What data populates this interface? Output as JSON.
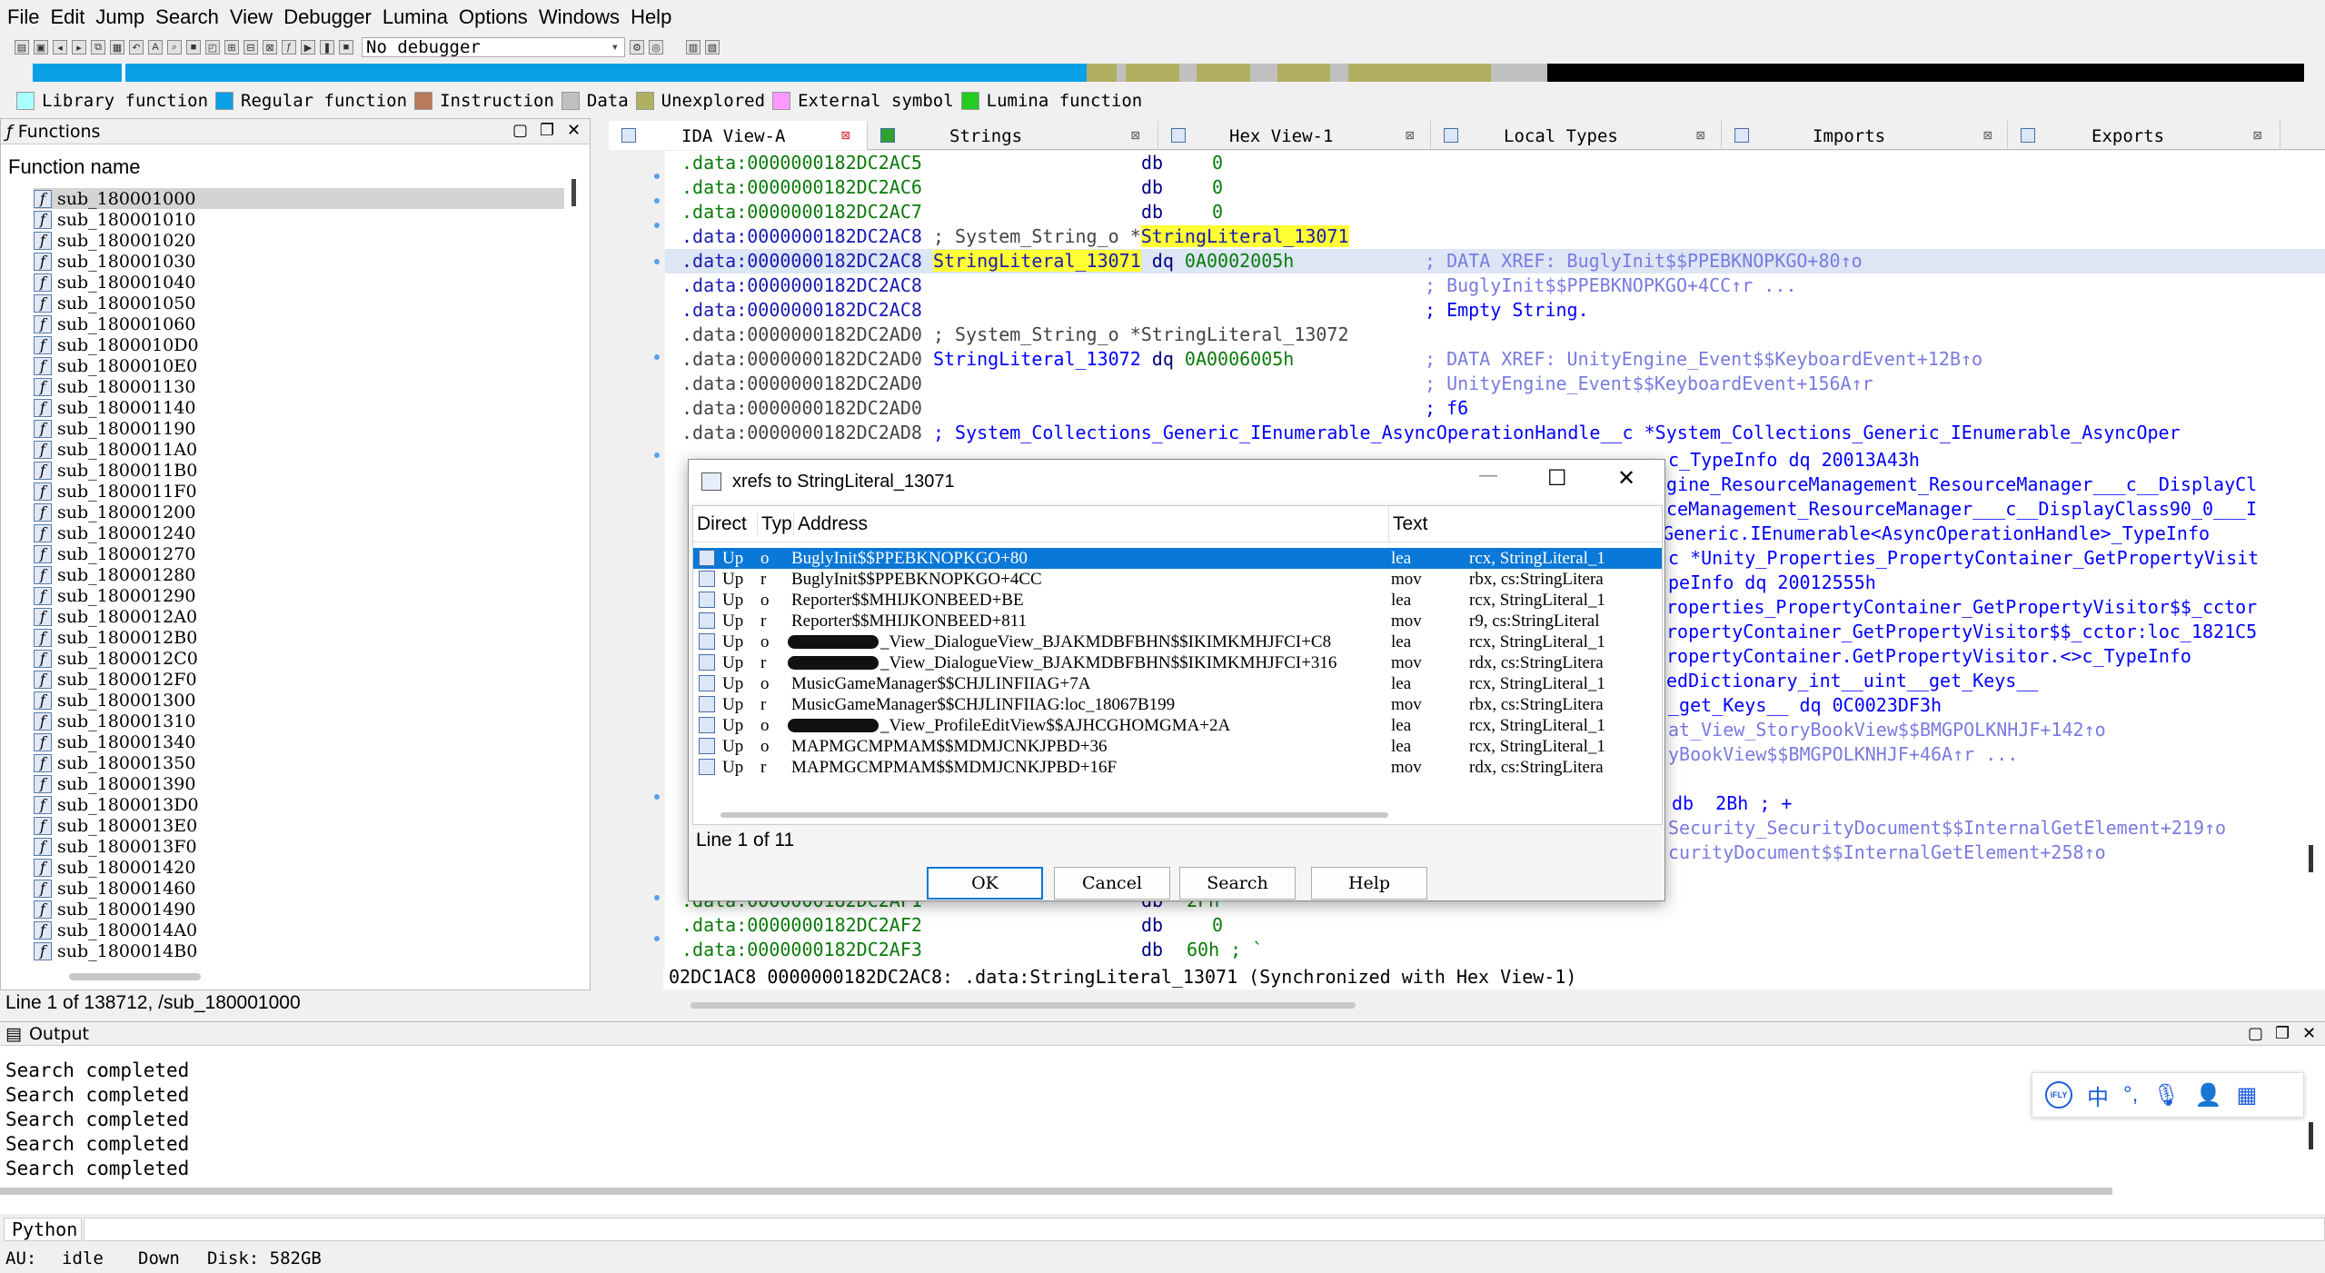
{
  "menu": [
    "File",
    "Edit",
    "Jump",
    "Search",
    "View",
    "Debugger",
    "Lumina",
    "Options",
    "Windows",
    "Help"
  ],
  "debugger_select": "No debugger",
  "legend": [
    {
      "label": "Library function",
      "color": "#aaffff"
    },
    {
      "label": "Regular function",
      "color": "#0aa0e6"
    },
    {
      "label": "Instruction",
      "color": "#b87a5a"
    },
    {
      "label": "Data",
      "color": "#c0c0c0"
    },
    {
      "label": "Unexplored",
      "color": "#b0b060"
    },
    {
      "label": "External symbol",
      "color": "#ff99ff"
    },
    {
      "label": "Lumina function",
      "color": "#22cc22"
    }
  ],
  "functions_panel": {
    "title": "Functions",
    "header": "Function name",
    "items": [
      "sub_180001000",
      "sub_180001010",
      "sub_180001020",
      "sub_180001030",
      "sub_180001040",
      "sub_180001050",
      "sub_180001060",
      "sub_1800010D0",
      "sub_1800010E0",
      "sub_180001130",
      "sub_180001140",
      "sub_180001190",
      "sub_1800011A0",
      "sub_1800011B0",
      "sub_1800011F0",
      "sub_180001200",
      "sub_180001240",
      "sub_180001270",
      "sub_180001280",
      "sub_180001290",
      "sub_1800012A0",
      "sub_1800012B0",
      "sub_1800012C0",
      "sub_1800012F0",
      "sub_180001300",
      "sub_180001310",
      "sub_180001340",
      "sub_180001350",
      "sub_180001390",
      "sub_1800013D0",
      "sub_1800013E0",
      "sub_1800013F0",
      "sub_180001420",
      "sub_180001460",
      "sub_180001490",
      "sub_1800014A0",
      "sub_1800014B0"
    ],
    "status": "Line 1 of 138712, /sub_180001000"
  },
  "tabs": [
    "IDA View-A",
    "Strings",
    "Hex View-1",
    "Local Types",
    "Imports",
    "Exports"
  ],
  "code_lines": [
    {
      "addr": ".data:0000000182DC2AC5",
      "label": "",
      "instr": "db",
      "arg": "0",
      "comment": ""
    },
    {
      "addr": ".data:0000000182DC2AC6",
      "label": "",
      "instr": "db",
      "arg": "0",
      "comment": ""
    },
    {
      "addr": ".data:0000000182DC2AC7",
      "label": "",
      "instr": "db",
      "arg": "0",
      "comment": ""
    },
    {
      "addr": ".data:0000000182DC2AC8",
      "label": "; System_String_o *",
      "instr": "StringLiteral_13071",
      "arg": "",
      "comment": ""
    },
    {
      "addr": ".data:0000000182DC2AC8",
      "label": "StringLiteral_13071",
      "instr": "dq",
      "arg": "0A0002005h",
      "comment": "; DATA XREF: BuglyInit$$PPEBKNOPKGO+80↑o"
    },
    {
      "addr": ".data:0000000182DC2AC8",
      "label": "",
      "instr": "",
      "arg": "",
      "comment": "; BuglyInit$$PPEBKNOPKGO+4CC↑r ..."
    },
    {
      "addr": ".data:0000000182DC2AC8",
      "label": "",
      "instr": "",
      "arg": "",
      "comment": "; Empty String."
    },
    {
      "addr": ".data:0000000182DC2AD0",
      "label": "; System_String_o *StringLiteral_13072",
      "instr": "",
      "arg": "",
      "comment": ""
    },
    {
      "addr": ".data:0000000182DC2AD0",
      "label": "StringLiteral_13072",
      "instr": "dq",
      "arg": "0A0006005h",
      "comment": "; DATA XREF: UnityEngine_Event$$KeyboardEvent+12B↑o"
    },
    {
      "addr": ".data:0000000182DC2AD0",
      "label": "",
      "instr": "",
      "arg": "",
      "comment": "; UnityEngine_Event$$KeyboardEvent+156A↑r"
    },
    {
      "addr": ".data:0000000182DC2AD0",
      "label": "",
      "instr": "",
      "arg": "",
      "comment": "; f6"
    },
    {
      "addr": ".data:0000000182DC2AD8",
      "label": "; System_Collections_Generic_IEnumerable_AsyncOperationHandle__c *System_Collections_Generic_IEnumerable_AsyncOper",
      "instr": "",
      "arg": "",
      "comment": ""
    }
  ],
  "right_fragments": [
    "c_TypeInfo dq 20013A43h",
    "gine_ResourceManagement_ResourceManager___c__DisplayCl",
    "ceManagement_ResourceManager___c__DisplayClass90_0___I",
    "Generic.IEnumerable<AsyncOperationHandle>_TypeInfo",
    "c *Unity_Properties_PropertyContainer_GetPropertyVisit",
    "peInfo dq 20012555h",
    "roperties_PropertyContainer_GetPropertyVisitor$$_cctor",
    "ropertyContainer_GetPropertyVisitor$$_cctor:loc_1821C5",
    "ropertyContainer.GetPropertyVisitor.<>c_TypeInfo",
    "edDictionary_int__uint__get_Keys__",
    "_get_Keys__ dq 0C0023DF3h",
    "at_View_StoryBookView$$BMGPOLKNHJF+142↑o",
    "yBookView$$BMGPOLKNHJF+46A↑r ...",
    "db  2Bh ; +",
    "Security_SecurityDocument$$InternalGetElement+219↑o",
    "curityDocument$$InternalGetElement+258↑o"
  ],
  "code_bottom": [
    {
      "addr": ".data:0000000182DC2AF1",
      "instr": "db",
      "arg": "2Fh"
    },
    {
      "addr": ".data:0000000182DC2AF2",
      "instr": "db",
      "arg": "0"
    },
    {
      "addr": ".data:0000000182DC2AF3",
      "instr": "db",
      "arg": "60h ; `"
    }
  ],
  "code_status": "02DC1AC8 0000000182DC2AC8: .data:StringLiteral_13071 (Synchronized with Hex View-1)",
  "dialog": {
    "title": "xrefs to StringLiteral_13071",
    "columns": [
      "Direct",
      "Typ",
      "Address",
      "Text"
    ],
    "rows": [
      {
        "dir": "Up",
        "type": "o",
        "address": "BuglyInit$$PPEBKNOPKGO+80",
        "mnem": "lea",
        "ops": "rcx, StringLiteral_1"
      },
      {
        "dir": "Up",
        "type": "r",
        "address": "BuglyInit$$PPEBKNOPKGO+4CC",
        "mnem": "mov",
        "ops": "rbx, cs:StringLitera"
      },
      {
        "dir": "Up",
        "type": "o",
        "address": "Reporter$$MHIJKONBEED+BE",
        "mnem": "lea",
        "ops": "rcx, StringLiteral_1"
      },
      {
        "dir": "Up",
        "type": "r",
        "address": "Reporter$$MHIJKONBEED+811",
        "mnem": "mov",
        "ops": "r9, cs:StringLiteral"
      },
      {
        "dir": "Up",
        "type": "o",
        "address": "_View_DialogueView_BJAKMDBFBHN$$IKIMKMHJFCI+C8",
        "mnem": "lea",
        "ops": "rcx, StringLiteral_1"
      },
      {
        "dir": "Up",
        "type": "r",
        "address": "_View_DialogueView_BJAKMDBFBHN$$IKIMKMHJFCI+316",
        "mnem": "mov",
        "ops": "rdx, cs:StringLitera"
      },
      {
        "dir": "Up",
        "type": "o",
        "address": "MusicGameManager$$CHJLINFIIAG+7A",
        "mnem": "lea",
        "ops": "rcx, StringLiteral_1"
      },
      {
        "dir": "Up",
        "type": "r",
        "address": "MusicGameManager$$CHJLINFIIAG:loc_18067B199",
        "mnem": "mov",
        "ops": "rbx, cs:StringLitera"
      },
      {
        "dir": "Up",
        "type": "o",
        "address": "_View_ProfileEditView$$AJHCGHOMGMA+2A",
        "mnem": "lea",
        "ops": "rcx, StringLiteral_1"
      },
      {
        "dir": "Up",
        "type": "o",
        "address": "MAPMGCMPMAM$$MDMJCNKJPBD+36",
        "mnem": "lea",
        "ops": "rcx, StringLiteral_1"
      },
      {
        "dir": "Up",
        "type": "r",
        "address": "MAPMGCMPMAM$$MDMJCNKJPBD+16F",
        "mnem": "mov",
        "ops": "rdx, cs:StringLitera"
      }
    ],
    "line_info": "Line 1 of 11",
    "buttons": {
      "ok": "OK",
      "cancel": "Cancel",
      "search": "Search",
      "help": "Help"
    }
  },
  "output": {
    "title": "Output",
    "lines": [
      "Search completed",
      "Search completed",
      "Search completed",
      "Search completed",
      "Search completed"
    ]
  },
  "python_label": "Python",
  "statusbar": {
    "au": "AU:",
    "au_state": "idle",
    "dir": "Down",
    "disk": "Disk: 582GB"
  },
  "ime": [
    "中",
    "°,",
    "mic",
    "user",
    "grid"
  ]
}
